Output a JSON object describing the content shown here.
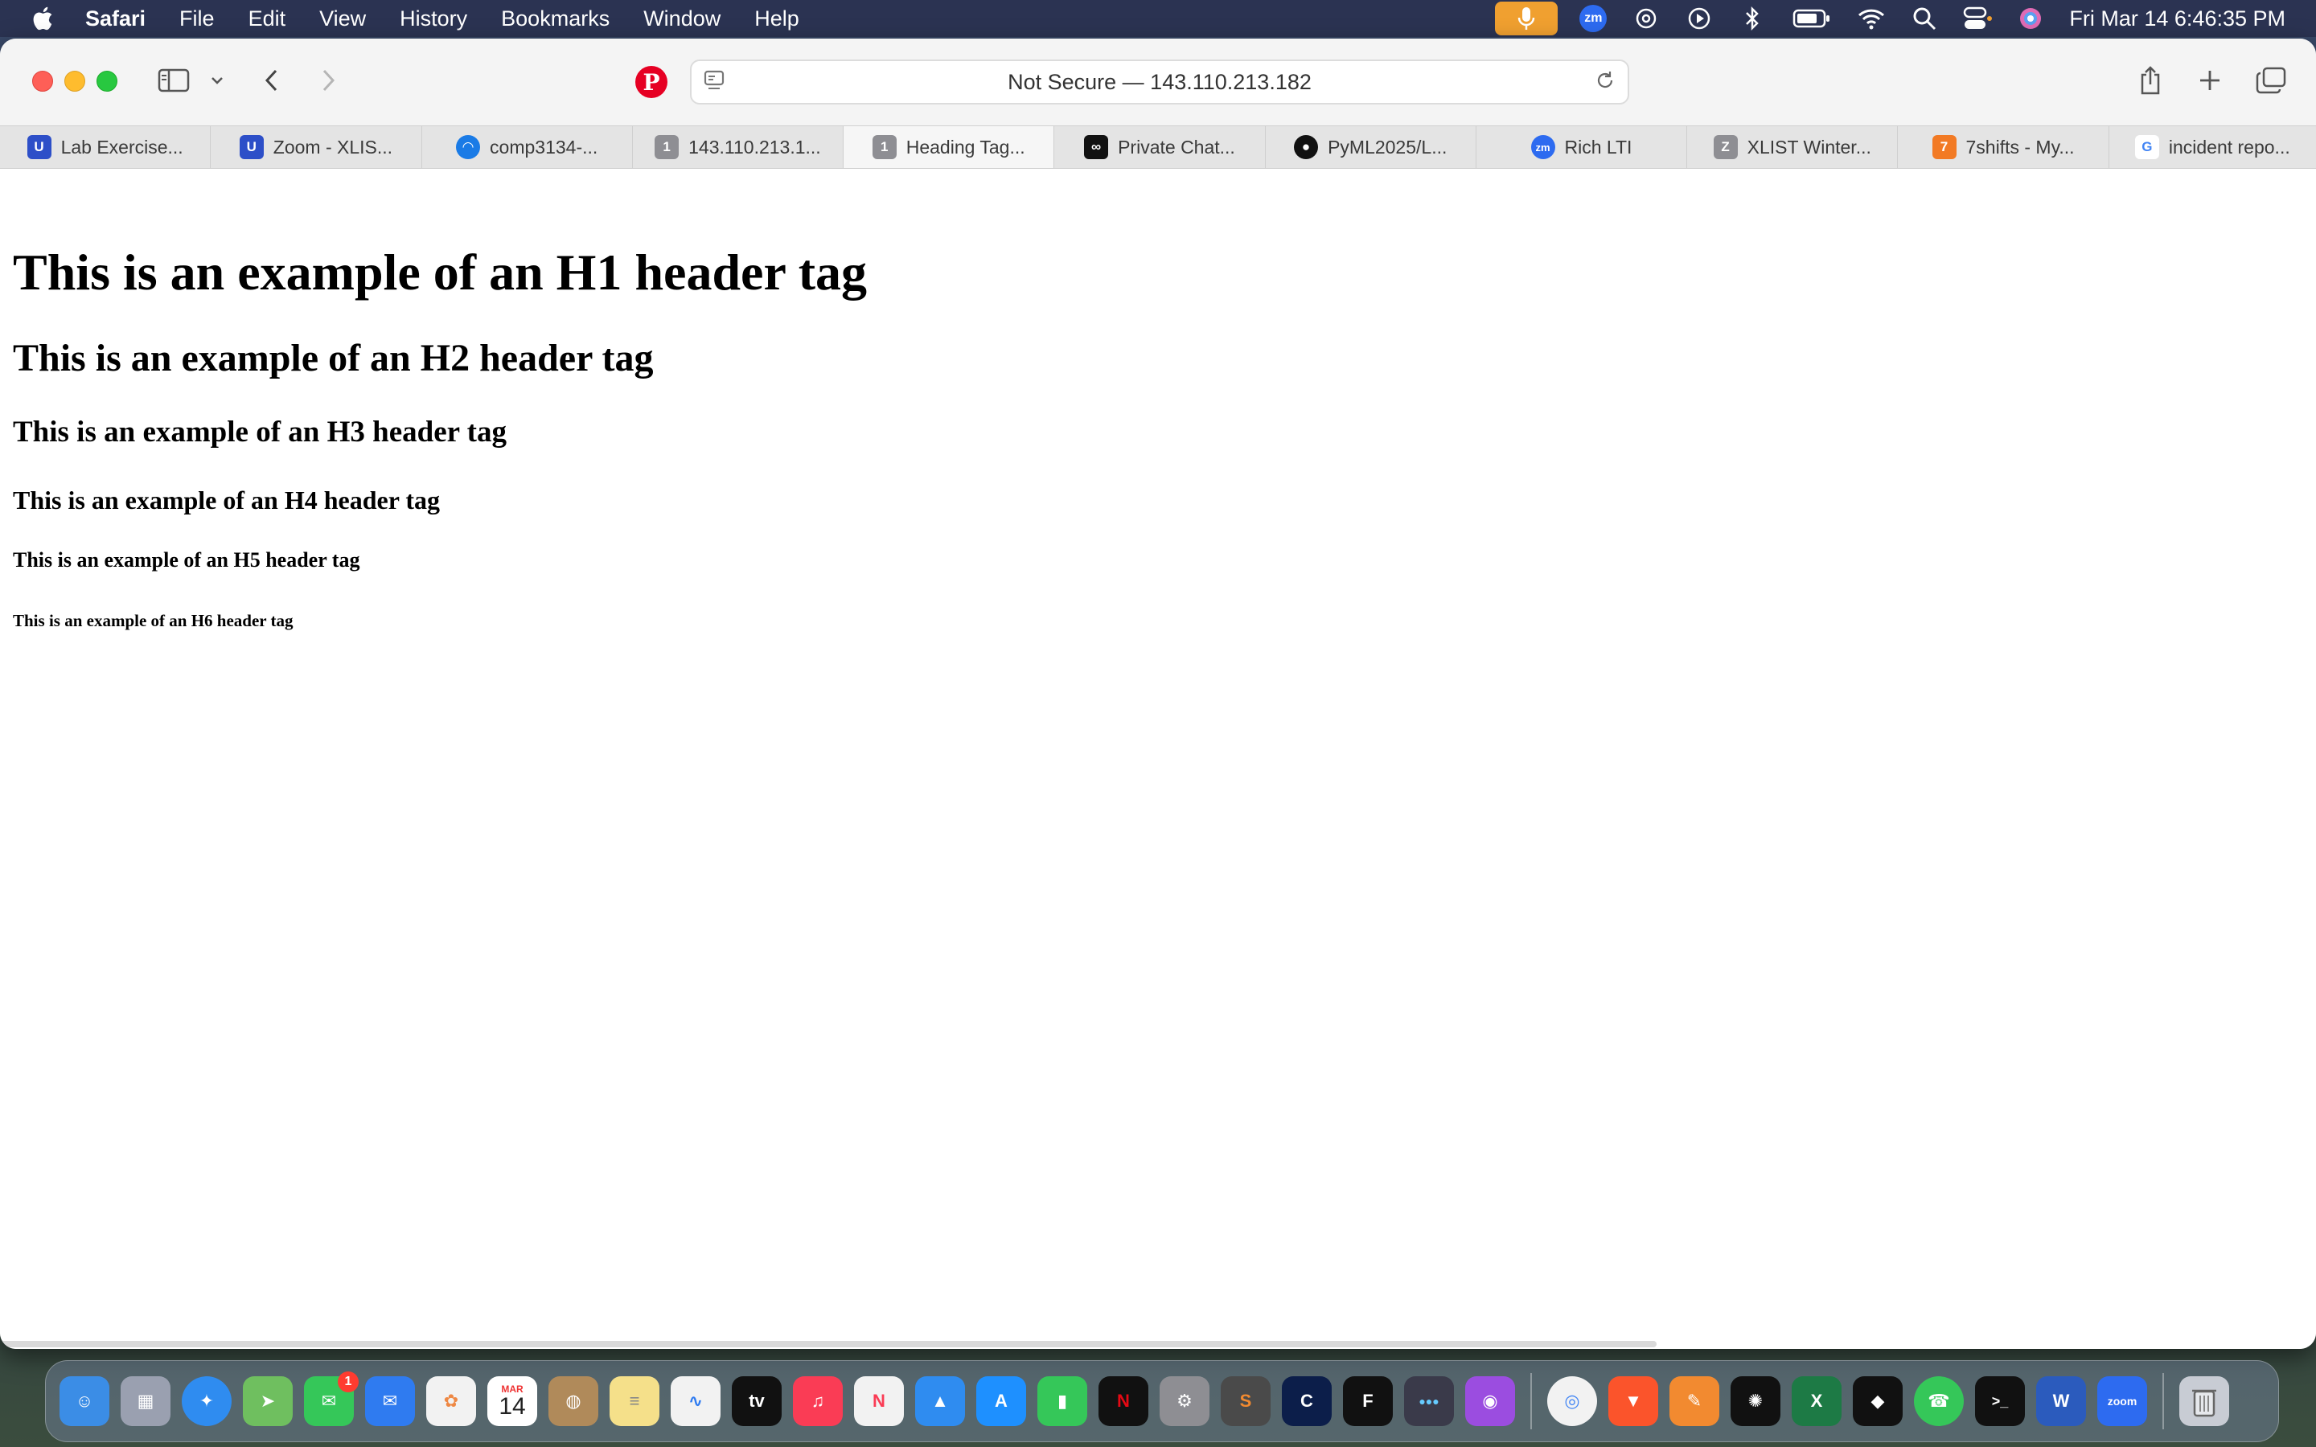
{
  "menubar": {
    "app_name": "Safari",
    "items": [
      "File",
      "Edit",
      "View",
      "History",
      "Bookmarks",
      "Window",
      "Help"
    ],
    "zoom_badge": "zm",
    "datetime": "Fri Mar 14  6:46:35 PM"
  },
  "toolbar": {
    "address": "Not Secure — 143.110.213.182",
    "pinterest_glyph": "P"
  },
  "tabs": [
    {
      "label": "Lab Exercise...",
      "icon": "lab-exercise-favicon",
      "color": "#2d4fc8",
      "glyph": "U"
    },
    {
      "label": "Zoom - XLIS...",
      "icon": "zoom-favicon",
      "color": "#2d4fc8",
      "glyph": "U"
    },
    {
      "label": "comp3134-...",
      "icon": "digitalocean-favicon",
      "color": "#1a7be6",
      "glyph": "◠"
    },
    {
      "label": "143.110.213.1...",
      "icon": "generic-1-favicon",
      "color": "#8e8e93",
      "glyph": "1"
    },
    {
      "label": "Heading Tag...",
      "icon": "generic-1-favicon",
      "color": "#8e8e93",
      "glyph": "1"
    },
    {
      "label": "Private Chat...",
      "icon": "private-chat-favicon",
      "color": "#111111",
      "glyph": "∞"
    },
    {
      "label": "PyML2025/L...",
      "icon": "github-favicon",
      "color": "#111111",
      "glyph": "●"
    },
    {
      "label": "Rich LTI",
      "icon": "zoom-favicon",
      "color": "#2d6bf0",
      "glyph": "zm"
    },
    {
      "label": "XLIST Winter...",
      "icon": "generic-z-favicon",
      "color": "#8e8e93",
      "glyph": "Z"
    },
    {
      "label": "7shifts - My...",
      "icon": "7shifts-favicon",
      "color": "#f27a24",
      "glyph": "7"
    },
    {
      "label": "incident repo...",
      "icon": "google-favicon",
      "color": "#ffffff",
      "glyph": "G"
    }
  ],
  "page": {
    "h1": "This is an example of an H1 header tag",
    "h2": "This is an example of an H2 header tag",
    "h3": "This is an example of an H3 header tag",
    "h4": "This is an example of an H4 header tag",
    "h5": "This is an example of an H5 header tag",
    "h6": "This is an example of an H6 header tag"
  },
  "dock": {
    "calendar_month": "MAR",
    "calendar_day": "14",
    "messages_badge": "1",
    "apps": [
      {
        "name": "finder-icon",
        "color": "#3b8de6",
        "glyph": "☺"
      },
      {
        "name": "launchpad-icon",
        "color": "#9aa0b0",
        "glyph": "▦"
      },
      {
        "name": "safari-icon",
        "color": "#2f8cf0",
        "glyph": "✦"
      },
      {
        "name": "maps-icon",
        "color": "#6fbf5f",
        "glyph": "➤"
      },
      {
        "name": "messages-icon",
        "color": "#35c759",
        "glyph": "✉"
      },
      {
        "name": "mail-icon",
        "color": "#2f7bf0",
        "glyph": "✉"
      },
      {
        "name": "photos-icon",
        "color": "#f2f2f2",
        "glyph": "✿"
      },
      {
        "name": "calendar-icon",
        "color": "#ffffff",
        "glyph": ""
      },
      {
        "name": "contacts-icon",
        "color": "#b08a5a",
        "glyph": "◍"
      },
      {
        "name": "notes-icon",
        "color": "#f5e08a",
        "glyph": "≡"
      },
      {
        "name": "freeform-icon",
        "color": "#f2f2f2",
        "glyph": "∿"
      },
      {
        "name": "apple-tv-icon",
        "color": "#111111",
        "glyph": "tv"
      },
      {
        "name": "music-icon",
        "color": "#fa3c55",
        "glyph": "♫"
      },
      {
        "name": "news-icon",
        "color": "#f2f2f2",
        "glyph": "N"
      },
      {
        "name": "keynote-icon",
        "color": "#2f8cf0",
        "glyph": "▲"
      },
      {
        "name": "app-store-icon",
        "color": "#1e90ff",
        "glyph": "A"
      },
      {
        "name": "numbers-icon",
        "color": "#35c759",
        "glyph": "▮"
      },
      {
        "name": "netflix-icon",
        "color": "#111111",
        "glyph": "N"
      },
      {
        "name": "system-settings-icon",
        "color": "#8e8e93",
        "glyph": "⚙"
      },
      {
        "name": "sublime-text-icon",
        "color": "#4a4a4a",
        "glyph": "S"
      },
      {
        "name": "codeblocks-icon",
        "color": "#0c1e4a",
        "glyph": "C"
      },
      {
        "name": "figma-icon",
        "color": "#111111",
        "glyph": "F"
      },
      {
        "name": "slack-dots-icon",
        "color": "#3a3a4a",
        "glyph": "●●●"
      },
      {
        "name": "podcasts-icon",
        "color": "#9b4de0",
        "glyph": "◉"
      }
    ],
    "apps_right": [
      {
        "name": "chrome-icon",
        "color": "#f2f2f2",
        "glyph": "◎"
      },
      {
        "name": "brave-icon",
        "color": "#fb542b",
        "glyph": "▼"
      },
      {
        "name": "pages-icon",
        "color": "#f28a30",
        "glyph": "✎"
      },
      {
        "name": "chatgpt-icon",
        "color": "#111111",
        "glyph": "✺"
      },
      {
        "name": "excel-icon",
        "color": "#1d7a45",
        "glyph": "X"
      },
      {
        "name": "cube-app-icon",
        "color": "#111111",
        "glyph": "◆"
      },
      {
        "name": "whatsapp-icon",
        "color": "#35c759",
        "glyph": "☎"
      },
      {
        "name": "terminal-icon",
        "color": "#111111",
        "glyph": ">_"
      },
      {
        "name": "word-icon",
        "color": "#2b5bbd",
        "glyph": "W"
      },
      {
        "name": "zoom-app-icon",
        "color": "#2d6bf0",
        "glyph": "zoom"
      },
      {
        "name": "trash-icon",
        "color": "#c8ccd4",
        "glyph": "🗑"
      }
    ]
  }
}
